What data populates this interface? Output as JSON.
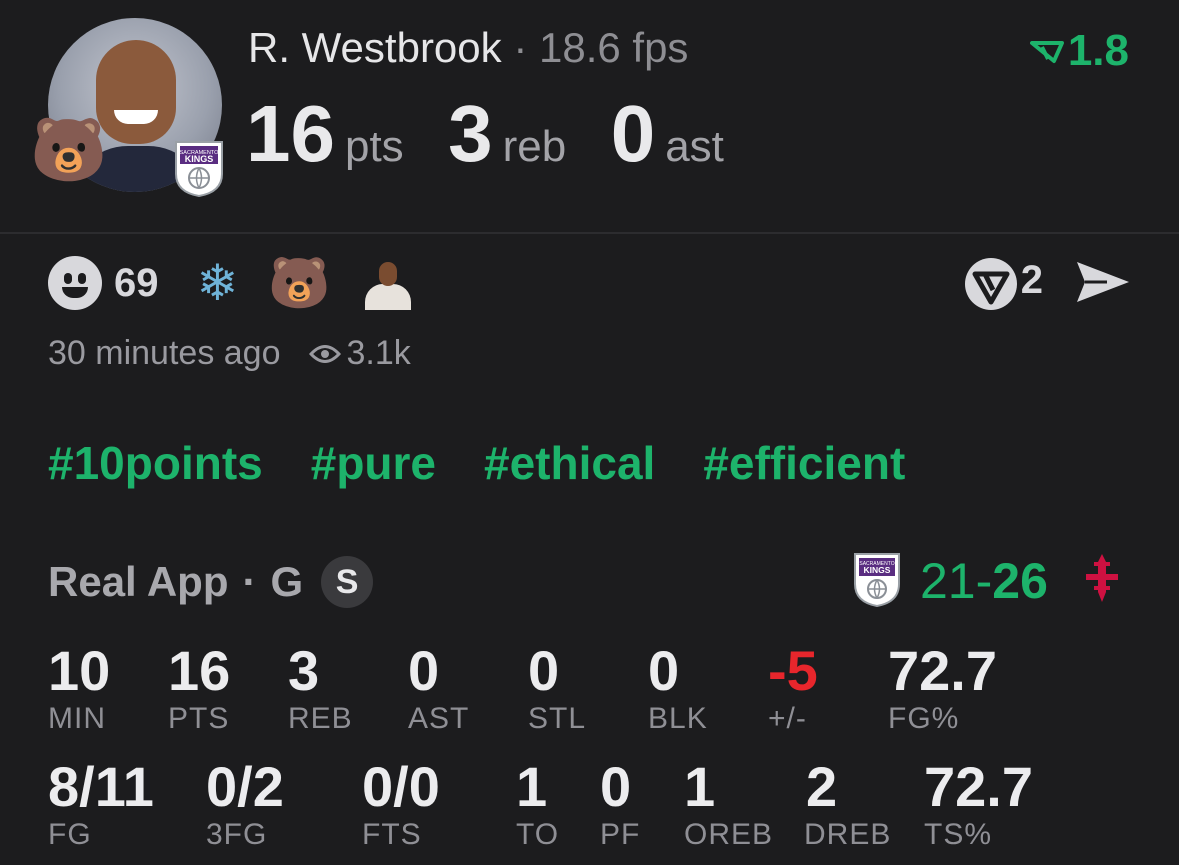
{
  "player": {
    "name": "R. Westbrook",
    "separator": "·",
    "fps": "18.6 fps",
    "rating": "1.8",
    "pts": "16",
    "pts_label": "pts",
    "reb": "3",
    "reb_label": "reb",
    "ast": "0",
    "ast_label": "ast",
    "team_logo_text": "KINGS",
    "team_logo_subtext": "SACRAMENTO",
    "badge_emoji": "🐻"
  },
  "reactions": {
    "smile_count": "69",
    "snowflake": "❄",
    "bear": "🐻",
    "veto_count": "2"
  },
  "meta": {
    "time_ago": "30 minutes ago",
    "views": "3.1k"
  },
  "tags": [
    "#10points",
    "#pure",
    "#ethical",
    "#efficient"
  ],
  "game": {
    "app": "Real App",
    "dot": "·",
    "position": "G",
    "badge": "S",
    "score_home": "21",
    "score_sep": "-",
    "score_away": "26"
  },
  "stats_row1": [
    {
      "value": "10",
      "label": "MIN"
    },
    {
      "value": "16",
      "label": "PTS"
    },
    {
      "value": "3",
      "label": "REB"
    },
    {
      "value": "0",
      "label": "AST"
    },
    {
      "value": "0",
      "label": "STL"
    },
    {
      "value": "0",
      "label": "BLK"
    },
    {
      "value": "-5",
      "label": "+/-"
    },
    {
      "value": "72.7",
      "label": "FG%"
    }
  ],
  "stats_row2": [
    {
      "value": "8/11",
      "label": "FG"
    },
    {
      "value": "0/2",
      "label": "3FG"
    },
    {
      "value": "0/0",
      "label": "FTS"
    },
    {
      "value": "1",
      "label": "TO"
    },
    {
      "value": "0",
      "label": "PF"
    },
    {
      "value": "1",
      "label": "OREB"
    },
    {
      "value": "2",
      "label": "DREB"
    },
    {
      "value": "72.7",
      "label": "TS%"
    }
  ],
  "colors": {
    "accent_green": "#1db36b",
    "negative_red": "#e8262c",
    "background": "#1c1c1e",
    "kings_purple": "#5a2d81"
  }
}
